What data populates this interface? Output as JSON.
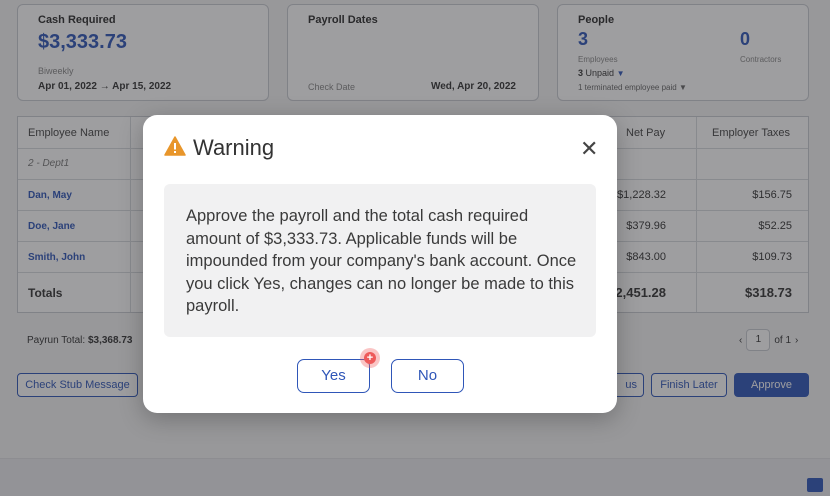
{
  "cards": {
    "cash": {
      "title": "Cash Required",
      "amount": "$3,333.73",
      "frequency": "Biweekly",
      "period_start": "Apr 01, 2022",
      "period_end": "Apr 15, 2022"
    },
    "payroll_dates": {
      "title": "Payroll Dates",
      "check_date_label": "Check Date",
      "check_date": "Wed, Apr 20, 2022"
    },
    "people": {
      "title": "People",
      "employees_count": "3",
      "employees_label": "Employees",
      "contractors_count": "0",
      "contractors_label": "Contractors",
      "unpaid_count": "3",
      "unpaid_label": "Unpaid",
      "terminated_text": "1 terminated employee paid"
    }
  },
  "table": {
    "headers": {
      "employee_name": "Employee Name",
      "net_pay": "Net Pay",
      "employer_taxes": "Employer Taxes"
    },
    "group_label": "2 - Dept1",
    "rows": [
      {
        "name": "Dan, May",
        "net_pay": "$1,228.32",
        "employer_taxes": "$156.75"
      },
      {
        "name": "Doe, Jane",
        "net_pay": "$379.96",
        "employer_taxes": "$52.25"
      },
      {
        "name": "Smith, John",
        "net_pay": "$843.00",
        "employer_taxes": "$109.73"
      }
    ],
    "totals": {
      "label": "Totals",
      "net_pay": "2,451.28",
      "employer_taxes": "$318.73"
    }
  },
  "payrun_total": {
    "label": "Payrun Total:",
    "value": "$3,368.73"
  },
  "pager": {
    "page": "1",
    "of_text": "of 1"
  },
  "buttons": {
    "check_stub": "Check Stub Message",
    "partial": "us",
    "finish_later": "Finish Later",
    "approve": "Approve"
  },
  "modal": {
    "title": "Warning",
    "message": "Approve the payroll and the total cash required amount of $3,333.73. Applicable funds will be impounded from your company's bank account. Once you click Yes, changes can no longer be made to this payroll.",
    "yes_label": "Yes",
    "no_label": "No",
    "close_glyph": "✕"
  },
  "colors": {
    "accent": "#2f56b8",
    "warning": "#e8962b"
  },
  "icons": {
    "warning": "warning-triangle-icon",
    "close": "close-icon",
    "chat": "chat-icon"
  }
}
